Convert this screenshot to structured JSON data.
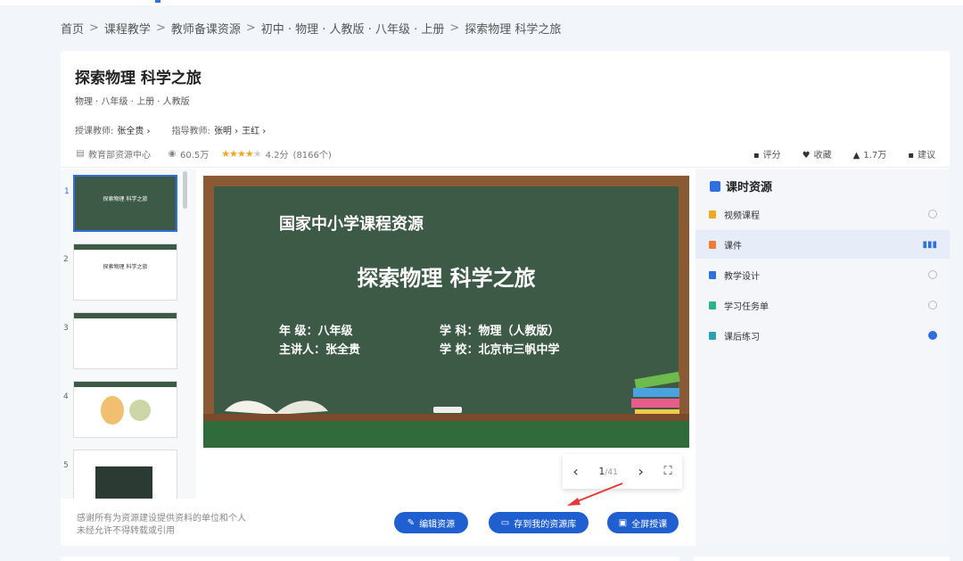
{
  "breadcrumb": [
    "首页",
    "课程教学",
    "教师备课资源",
    "初中 · 物理 · 人教版 · 八年级 · 上册",
    "探索物理 科学之旅"
  ],
  "breadcrumb_sep": ">",
  "course": {
    "title": "探索物理 科学之旅",
    "subtitle": "物理 · 八年级 · 上册 · 人教版",
    "teacher_label": "授课教师:",
    "teacher": "张全贵 ›",
    "guide_label": "指导教师:",
    "guide1": "张明 ›",
    "guide2": "王红 ›"
  },
  "meta": {
    "source": "教育部资源中心",
    "views": "60.5万",
    "rating_stars": 4,
    "rating": "4.2分",
    "rating_count": "(8166个)"
  },
  "actions": {
    "rate": "评分",
    "favorite": "收藏",
    "likes": "1.7万",
    "suggest": "建议"
  },
  "thumbnails": [
    {
      "num": "1",
      "title": "探索物理 科学之旅"
    },
    {
      "num": "2",
      "title": "探索物理 科学之旅"
    },
    {
      "num": "3",
      "title": ""
    },
    {
      "num": "4",
      "title": ""
    },
    {
      "num": "5",
      "title": ""
    }
  ],
  "slide": {
    "header": "国家中小学课程资源",
    "title": "探索物理 科学之旅",
    "grade": "年  级：八年级",
    "subject": "学  科：物理（人教版）",
    "speaker": "主讲人：张全贵",
    "school": "学  校：北京市三帆中学"
  },
  "pager": {
    "current": "1",
    "total": "/41"
  },
  "notice": {
    "line1": "感谢所有为资源建设提供资料的单位和个人",
    "line2": "未经允许不得转载或引用"
  },
  "buttons": {
    "edit": "编辑资源",
    "save": "存到我的资源库",
    "fullscreen": "全屏授课"
  },
  "side": {
    "title": "课时资源",
    "items": [
      {
        "label": "视频课程",
        "color": "#f5a623",
        "status": "empty"
      },
      {
        "label": "课件",
        "color": "#f07a3a",
        "status": "playing"
      },
      {
        "label": "教学设计",
        "color": "#2f6fe0",
        "status": "empty"
      },
      {
        "label": "学习任务单",
        "color": "#27b58a",
        "status": "empty"
      },
      {
        "label": "课后练习",
        "color": "#27a3b5",
        "status": "done"
      }
    ]
  }
}
